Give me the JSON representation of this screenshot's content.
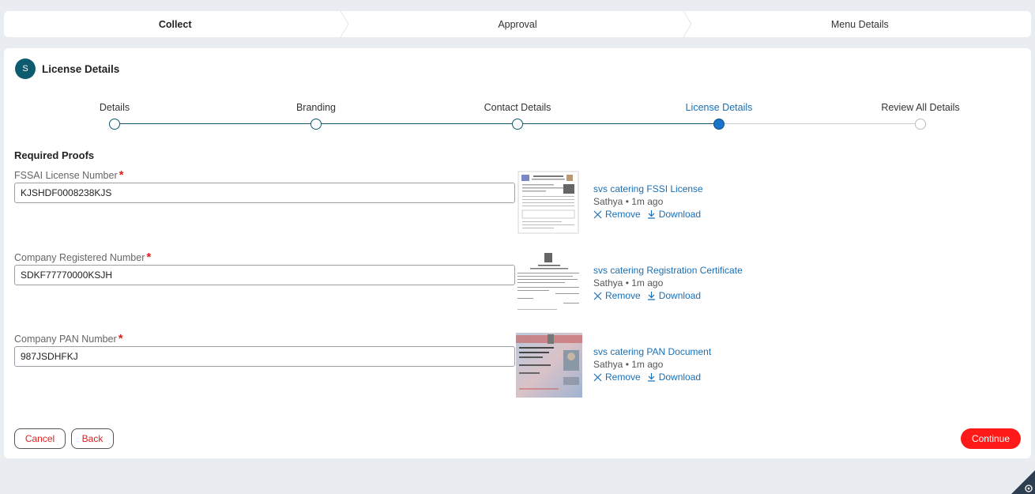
{
  "wizard": {
    "steps": [
      {
        "label": "Collect"
      },
      {
        "label": "Approval"
      },
      {
        "label": "Menu Details"
      }
    ]
  },
  "header": {
    "avatar_letter": "S",
    "title": "License Details"
  },
  "progress": {
    "steps": [
      {
        "label": "Details"
      },
      {
        "label": "Branding"
      },
      {
        "label": "Contact Details"
      },
      {
        "label": "License Details"
      },
      {
        "label": "Review All Details"
      }
    ],
    "current_index": 3
  },
  "proofs": {
    "title": "Required Proofs",
    "required_marker": "*",
    "fields": [
      {
        "label": "FSSAI License Number",
        "value": "KJSHDF0008238KJS",
        "doc_name": "svs catering FSSI License",
        "uploader": "Sathya",
        "time": "1m ago"
      },
      {
        "label": "Company Registered Number",
        "value": "SDKF77770000KSJH",
        "doc_name": "svs catering Registration Certificate",
        "uploader": "Sathya",
        "time": "1m ago"
      },
      {
        "label": "Company PAN Number",
        "value": "987JSDHFKJ",
        "doc_name": "svs catering PAN Document",
        "uploader": "Sathya",
        "time": "1m ago"
      }
    ],
    "bullet": "•",
    "remove_label": "Remove",
    "download_label": "Download"
  },
  "footer": {
    "cancel_label": "Cancel",
    "back_label": "Back",
    "continue_label": "Continue"
  },
  "colors": {
    "accent": "#0d5b6f",
    "link": "#1a6fb5",
    "primary_button": "#ff1a1a"
  }
}
